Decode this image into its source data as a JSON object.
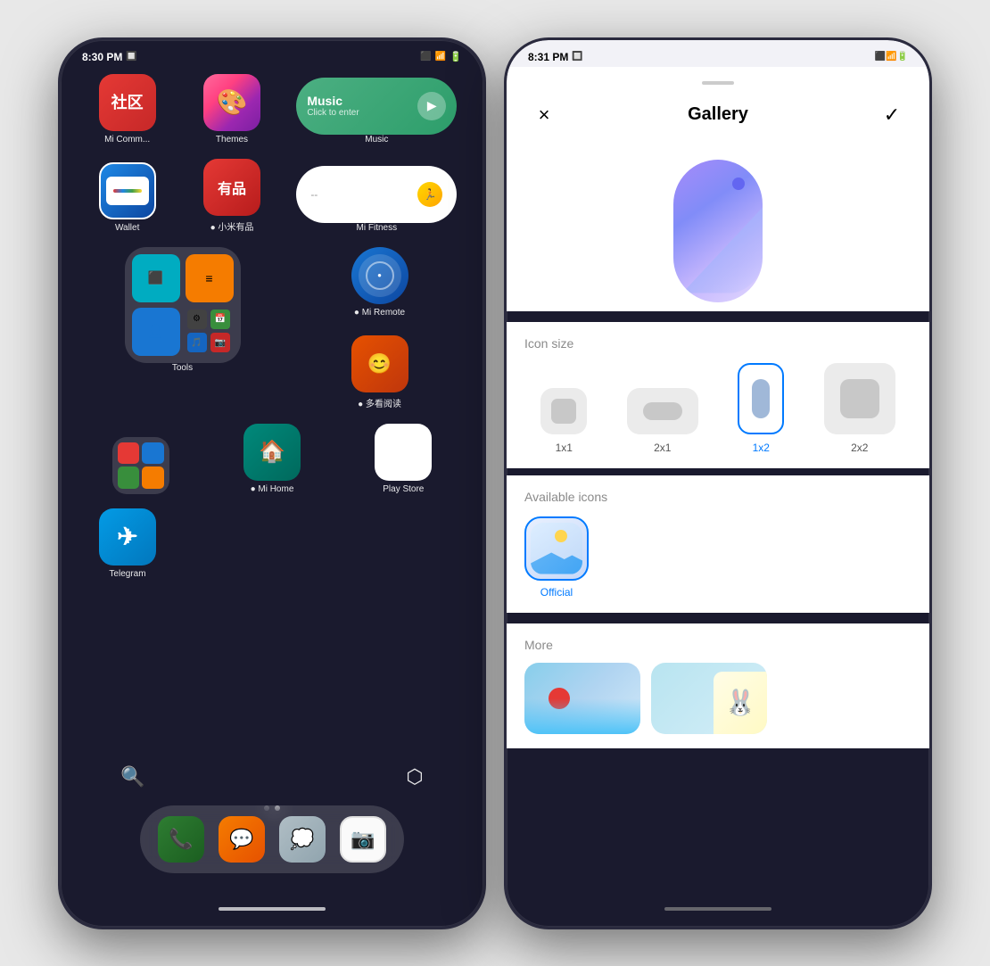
{
  "leftPhone": {
    "statusBar": {
      "time": "8:30 PM",
      "icons": [
        "📷",
        "📶",
        "🔋"
      ]
    },
    "apps": {
      "row1": [
        {
          "label": "Mi Comm...",
          "icon": "社区",
          "iconClass": "icon-micomm"
        },
        {
          "label": "Themes",
          "icon": "🎨",
          "iconClass": "icon-themes"
        },
        {
          "label": "Music",
          "widget": true
        }
      ],
      "row2": [
        {
          "label": "Wallet",
          "icon": "💳",
          "iconClass": "icon-wallet"
        },
        {
          "label": "小米有品",
          "icon": "有品",
          "iconClass": "icon-youpin"
        },
        {
          "label": "Mi Fitness",
          "widget": "fitness"
        }
      ],
      "row3": [
        {
          "label": "Tools",
          "folder": true
        },
        {
          "label": "Mi Remote",
          "icon": "⚙",
          "iconClass": "icon-miremote",
          "dot": true
        },
        {
          "label": "多看阅读",
          "icon": "📖",
          "iconClass": "icon-duokan",
          "dot": true
        }
      ],
      "row4": [
        {
          "label": "",
          "folder": true
        },
        {
          "label": "Mi Home",
          "icon": "🏠",
          "iconClass": "icon-mihome",
          "dot": true
        },
        {
          "label": "Play Store",
          "icon": "▶",
          "iconClass": "icon-playstore"
        }
      ],
      "telegram": {
        "label": "Telegram",
        "iconClass": "icon-telegram"
      }
    },
    "dock": [
      {
        "label": "Phone",
        "iconClass": "icon-phone"
      },
      {
        "label": "Messages",
        "iconClass": "icon-messages"
      },
      {
        "label": "Chat",
        "iconClass": "icon-chat"
      },
      {
        "label": "Camera",
        "iconClass": "icon-camera"
      }
    ]
  },
  "rightPhone": {
    "statusBar": {
      "time": "8:31 PM"
    },
    "header": {
      "closeLabel": "×",
      "title": "Gallery",
      "checkLabel": "✓"
    },
    "iconSizes": [
      {
        "label": "1x1",
        "selected": false,
        "class": "s11"
      },
      {
        "label": "2x1",
        "selected": false,
        "class": "s21"
      },
      {
        "label": "1x2",
        "selected": true,
        "class": "s12"
      },
      {
        "label": "2x2",
        "selected": false,
        "class": "s22"
      }
    ],
    "sectionTitles": {
      "iconSize": "Icon size",
      "availableIcons": "Available icons",
      "more": "More"
    },
    "availableIcons": [
      {
        "label": "Official",
        "selected": true
      }
    ]
  }
}
